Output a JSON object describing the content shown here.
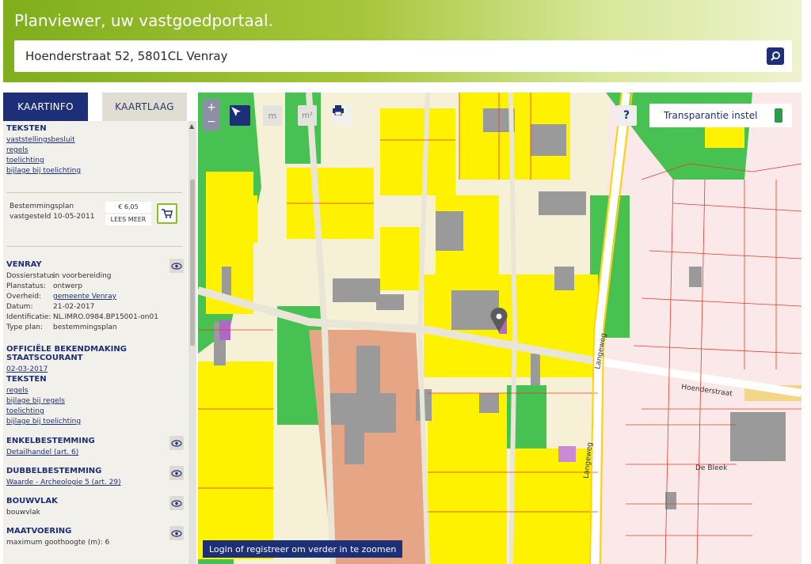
{
  "header": {
    "title": "Planviewer, uw vastgoedportaal.",
    "search_value": "Hoenderstraat 52, 5801CL Venray",
    "search_icon": "search-icon"
  },
  "tabs": {
    "kaartinfo": "KAARTINFO",
    "kaartlaag": "KAARTLAAG"
  },
  "panel": {
    "teksten_top": {
      "title": "TEKSTEN",
      "links": [
        "vaststellingsbesluit",
        "regels",
        "toelichting",
        "bijlage bij toelichting"
      ]
    },
    "plan": {
      "label": "Bestemmingsplan vastgesteld 10-05-2011",
      "price": "€ 6,05",
      "read_more": "LEES MEER",
      "cart_icon": "cart-icon"
    },
    "venray": {
      "title": "VENRAY",
      "rows": [
        {
          "key": "Dossierstatus:",
          "value": "in voorbereiding"
        },
        {
          "key": "Planstatus:",
          "value": "ontwerp"
        },
        {
          "key": "Overheid:",
          "value": "gemeente Venray"
        },
        {
          "key": "Datum:",
          "value": "21-02-2017"
        },
        {
          "key": "Identificatie:",
          "value": "NL.IMRO.0984.BP15001-on01"
        },
        {
          "key": "Type plan:",
          "value": "bestemmingsplan"
        }
      ]
    },
    "bekendmaking": {
      "title": "OFFICIËLE BEKENDMAKING STAATSCOURANT",
      "date": "02-03-2017"
    },
    "teksten_bottom": {
      "title": "TEKSTEN",
      "links": [
        "regels",
        "bijlage bij regels",
        "toelichting",
        "bijlage bij toelichting"
      ]
    },
    "enkel": {
      "title": "ENKELBESTEMMING",
      "value": "Detailhandel (art. 6)"
    },
    "dubbel": {
      "title": "DUBBELBESTEMMING",
      "value": "Waarde - Archeologie 5 (art. 29)"
    },
    "bouwvlak": {
      "title": "BOUWVLAK",
      "value": "bouwvlak"
    },
    "maatvoering": {
      "title": "MAATVOERING",
      "value": "maximum goothoogte (m): 6"
    }
  },
  "map": {
    "transparency_label": "Transparantie instel",
    "help_label": "?",
    "login_banner": "Login of registreer om verder in te zoomen",
    "streets": [
      "Langeweg",
      "Hoenderstraat",
      "De Bleek",
      "Langeweg"
    ],
    "colors": {
      "yellow": "#fff200",
      "green": "#46c152",
      "salmon": "#e6a686",
      "red_line": "#e23a2e",
      "building": "#9a9a9a",
      "brand": "#1d2f76"
    }
  }
}
